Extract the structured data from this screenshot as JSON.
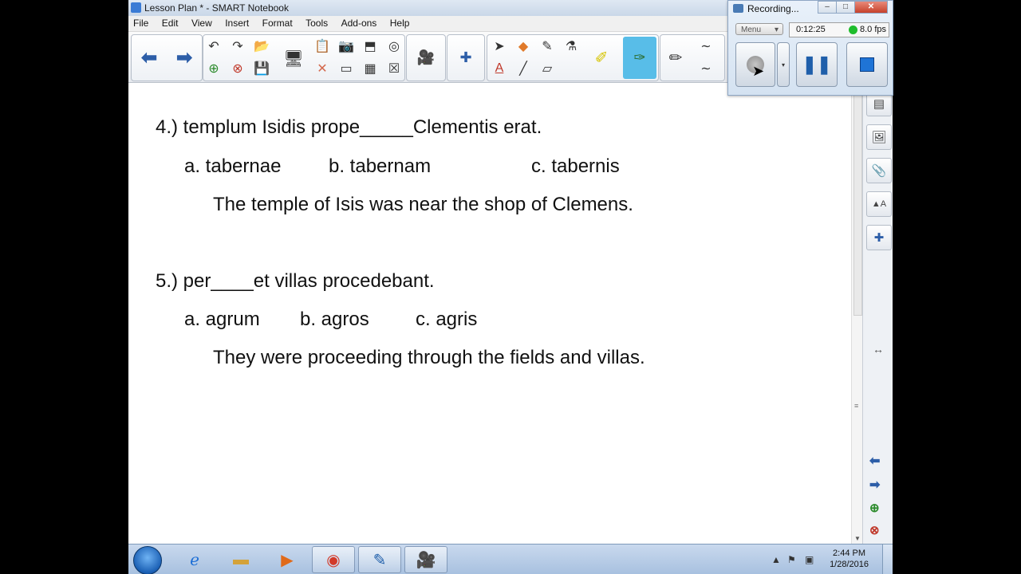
{
  "window": {
    "title": "Lesson Plan * - SMART Notebook"
  },
  "menu": [
    "File",
    "Edit",
    "View",
    "Insert",
    "Format",
    "Tools",
    "Add-ons",
    "Help"
  ],
  "content": {
    "q4": {
      "prompt": "4.) templum Isidis prope_____Clementis erat.",
      "option_a": "a. tabernae",
      "option_b": "b. tabernam",
      "option_c": "c. tabernis",
      "translation": "The temple of Isis was near the shop of Clemens."
    },
    "q5": {
      "prompt": "5.) per____et villas procedebant.",
      "option_a": "a. agrum",
      "option_b": "b. agros",
      "option_c": "c. agris",
      "translation": "They were proceeding through the fields and villas."
    }
  },
  "recorder": {
    "title": "Recording...",
    "menu_label": "Menu",
    "elapsed": "0:12:25",
    "fps": "8.0 fps",
    "status_color": "#1fbd2c"
  },
  "taskbar": {
    "time": "2:44 PM",
    "date": "1/28/2016"
  },
  "colors": {
    "toolbar_active": "#58bde8",
    "nav_arrow": "#2d5ea8"
  }
}
